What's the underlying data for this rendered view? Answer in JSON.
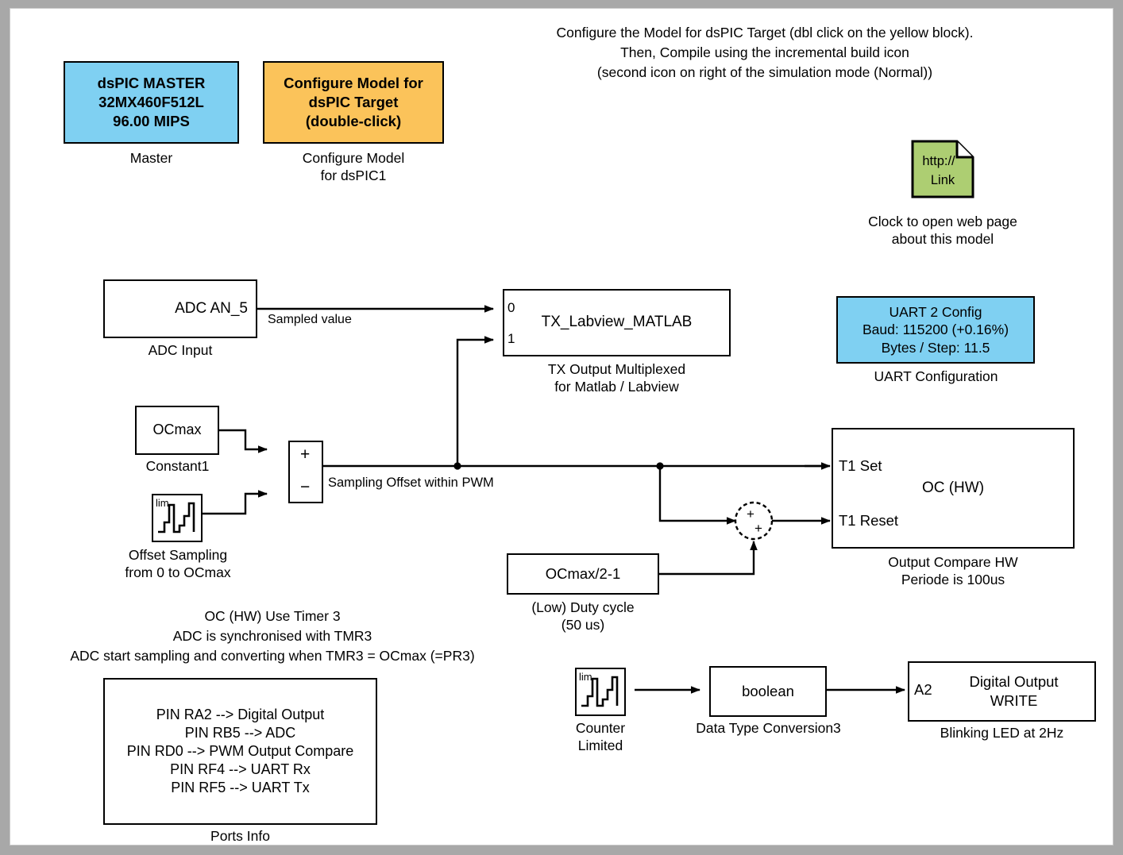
{
  "canvas": {
    "background": "#ffffff",
    "frame_color": "#a8a8a8"
  },
  "annotations": {
    "top_note": "Configure the Model for dsPIC Target (dbl click on the yellow block).\nThen, Compile using the incremental build icon\n(second icon on right of the simulation mode (Normal))",
    "timer_note": "OC (HW) Use Timer 3\nADC is synchronised with TMR3\nADC start sampling and converting when TMR3 = OCmax (=PR3)"
  },
  "blocks": {
    "master": {
      "text": "dsPIC MASTER\n32MX460F512L\n96.00 MIPS",
      "caption": "Master",
      "color": "#7fd0f2"
    },
    "configure_model": {
      "text": "Configure Model for\ndsPIC Target\n(double-click)",
      "caption": "Configure Model\nfor dsPIC1",
      "color": "#fbc35a"
    },
    "web_link": {
      "line1": "http://",
      "line2": "Link",
      "caption": "Clock to open web page\nabout this model",
      "color": "#adce72"
    },
    "adc_input": {
      "text": "ADC   AN_5",
      "caption": "ADC Input"
    },
    "tx_mux": {
      "text": "TX_Labview_MATLAB",
      "caption": "TX Output Multiplexed\nfor Matlab / Labview",
      "port0": "0",
      "port1": "1"
    },
    "uart_config": {
      "text": "UART 2 Config\nBaud: 115200 (+0.16%)\nBytes / Step: 11.5",
      "caption": "UART Configuration",
      "color": "#7fd0f2"
    },
    "constant1": {
      "text": "OCmax",
      "caption": "Constant1"
    },
    "offset_sampling": {
      "icon": "counter-limited-waveform-icon",
      "icon_label": "lim",
      "caption": "Offset Sampling\nfrom 0 to OCmax"
    },
    "sum_subtract": {
      "plus": "+",
      "minus": "−"
    },
    "sum_add": {
      "plus1": "+",
      "plus2": "+"
    },
    "duty_cycle": {
      "text": "OCmax/2-1",
      "caption": "(Low) Duty cycle\n(50 us)"
    },
    "output_compare": {
      "text": "OC (HW)",
      "port_set": "T1 Set",
      "port_reset": "T1 Reset",
      "caption": "Output Compare HW\nPeriode is 100us"
    },
    "ports_info": {
      "lines": [
        "PIN RA2 --> Digital Output",
        "PIN RB5 --> ADC",
        "PIN RD0 --> PWM Output Compare",
        "PIN RF4 --> UART Rx",
        "PIN RF5 --> UART Tx"
      ],
      "caption": "Ports Info"
    },
    "counter_limited": {
      "icon": "counter-limited-waveform-icon",
      "icon_label": "lim",
      "caption": "Counter\nLimited"
    },
    "data_type_conversion": {
      "text": "boolean",
      "caption": "Data Type Conversion3"
    },
    "digital_output": {
      "port": "A2",
      "text": "Digital Output\nWRITE",
      "caption": "Blinking LED at 2Hz"
    }
  },
  "signal_labels": {
    "sampled_value": "Sampled value",
    "sampling_offset": "Sampling Offset within PWM"
  }
}
